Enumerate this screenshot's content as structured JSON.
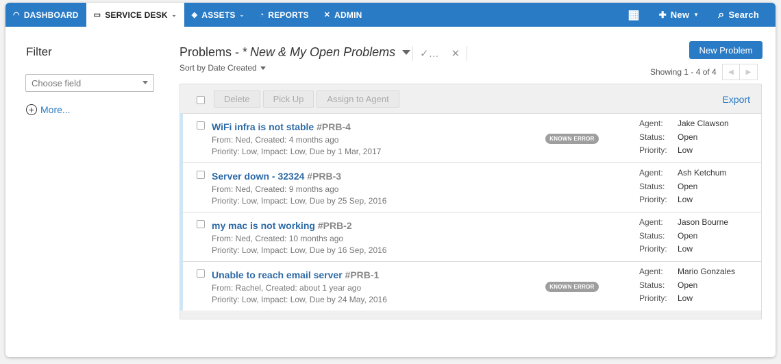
{
  "nav": {
    "items": [
      {
        "label": "DASHBOARD",
        "icon": "gauge-icon",
        "glyph": "◠"
      },
      {
        "label": "SERVICE DESK",
        "icon": "monitor-icon",
        "glyph": "▭",
        "caret": "⌄"
      },
      {
        "label": "ASSETS",
        "icon": "cube-icon",
        "glyph": "◈",
        "caret": "⌄"
      },
      {
        "label": "REPORTS",
        "icon": "pie-chart-icon",
        "glyph": "◔"
      },
      {
        "label": "ADMIN",
        "icon": "tools-icon",
        "glyph": "✕"
      }
    ],
    "new_label": "New",
    "search_label": "Search",
    "calendar_glyph": "▦",
    "plus_glyph": "✚",
    "search_glyph": "⌕",
    "accent": "#2a7bc5"
  },
  "sidebar": {
    "title": "Filter",
    "field_placeholder": "Choose field",
    "more_label": "More...",
    "plus_glyph": "+"
  },
  "header": {
    "title_prefix": "Problems - *",
    "view_name": "New & My Open Problems",
    "check_glyph": "✓…",
    "close_glyph": "✕",
    "sort_label": "Sort by Date Created",
    "new_button": "New Problem",
    "showing": "Showing 1 - 4 of 4",
    "prev_glyph": "◀",
    "next_glyph": "▶"
  },
  "toolbar": {
    "delete": "Delete",
    "pick_up": "Pick Up",
    "assign": "Assign to Agent",
    "export": "Export"
  },
  "rows": [
    {
      "title": "WiFi infra is not stable",
      "id": "#PRB-4",
      "meta1": "From: Ned, Created: 4 months ago",
      "meta2": "Priority: Low,  Impact: Low,  Due by 1 Mar, 2017",
      "badge": "KNOWN ERROR",
      "agent_label": "Agent:",
      "agent": "Jake Clawson",
      "status_label": "Status:",
      "status": "Open",
      "priority_label": "Priority:",
      "priority": "Low"
    },
    {
      "title": "Server down - 32324",
      "id": "#PRB-3",
      "meta1": "From: Ned, Created: 9 months ago",
      "meta2": "Priority: Low,  Impact: Low,  Due by 25 Sep, 2016",
      "badge": "",
      "agent_label": "Agent:",
      "agent": "Ash Ketchum",
      "status_label": "Status:",
      "status": "Open",
      "priority_label": "Priority:",
      "priority": "Low"
    },
    {
      "title": "my mac is not working",
      "id": "#PRB-2",
      "meta1": "From: Ned, Created: 10 months ago",
      "meta2": "Priority: Low,  Impact: Low,  Due by 16 Sep, 2016",
      "badge": "",
      "agent_label": "Agent:",
      "agent": "Jason Bourne",
      "status_label": "Status:",
      "status": "Open",
      "priority_label": "Priority:",
      "priority": "Low"
    },
    {
      "title": "Unable to reach email server",
      "id": "#PRB-1",
      "meta1": "From: Rachel, Created: about 1 year ago",
      "meta2": "Priority: Low,  Impact: Low,  Due by 24 May, 2016",
      "badge": "KNOWN ERROR",
      "agent_label": "Agent:",
      "agent": "Mario Gonzales",
      "status_label": "Status:",
      "status": "Open",
      "priority_label": "Priority:",
      "priority": "Low"
    }
  ]
}
